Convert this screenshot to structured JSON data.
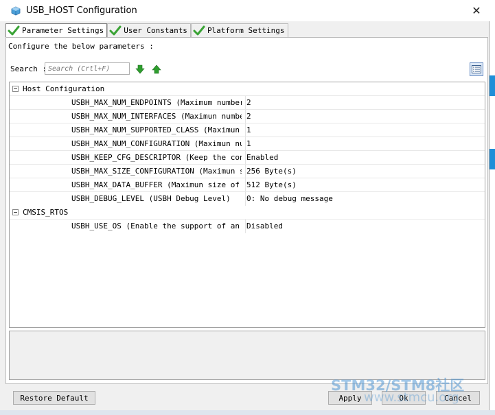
{
  "window": {
    "title": "USB_HOST Configuration",
    "close_glyph": "✕"
  },
  "tabs": [
    {
      "label": "Parameter Settings",
      "active": true
    },
    {
      "label": "User Constants",
      "active": false
    },
    {
      "label": "Platform Settings",
      "active": false
    }
  ],
  "panel": {
    "instruction": "Configure the below parameters :",
    "search_label": "Search :",
    "search_placeholder": "Search (Crtl+F)"
  },
  "groups": [
    {
      "label": "Host Configuration",
      "params": [
        {
          "name": "USBH_MAX_NUM_ENDPOINTS (Maximum number ...",
          "value": "2"
        },
        {
          "name": "USBH_MAX_NUM_INTERFACES (Maximun number...",
          "value": "2"
        },
        {
          "name": "USBH_MAX_NUM_SUPPORTED_CLASS (Maximun n...",
          "value": "1"
        },
        {
          "name": "USBH_MAX_NUM_CONFIGURATION (Maximun num...",
          "value": "1"
        },
        {
          "name": "USBH_KEEP_CFG_DESCRIPTOR (Keep the conf...",
          "value": "Enabled"
        },
        {
          "name": "USBH_MAX_SIZE_CONFIGURATION (Maximun si...",
          "value": "256 Byte(s)"
        },
        {
          "name": "USBH_MAX_DATA_BUFFER (Maximun size of t...",
          "value": "512 Byte(s)"
        },
        {
          "name": "USBH_DEBUG_LEVEL (USBH Debug Level)",
          "value": "0: No debug message"
        }
      ]
    },
    {
      "label": "CMSIS_RTOS",
      "params": [
        {
          "name": "USBH_USE_OS (Enable the support of an R...",
          "value": "Disabled"
        }
      ]
    }
  ],
  "buttons": {
    "restore_default": "Restore Default",
    "apply": "Apply",
    "ok": "Ok",
    "cancel": "Cancel"
  },
  "watermark": {
    "brand": "STM32/STM8社区",
    "url": "www.stmcu.org"
  },
  "colors": {
    "check_green": "#3aa335",
    "arrow_green": "#2e9e2e",
    "accent_blue": "#1f8fd8"
  }
}
